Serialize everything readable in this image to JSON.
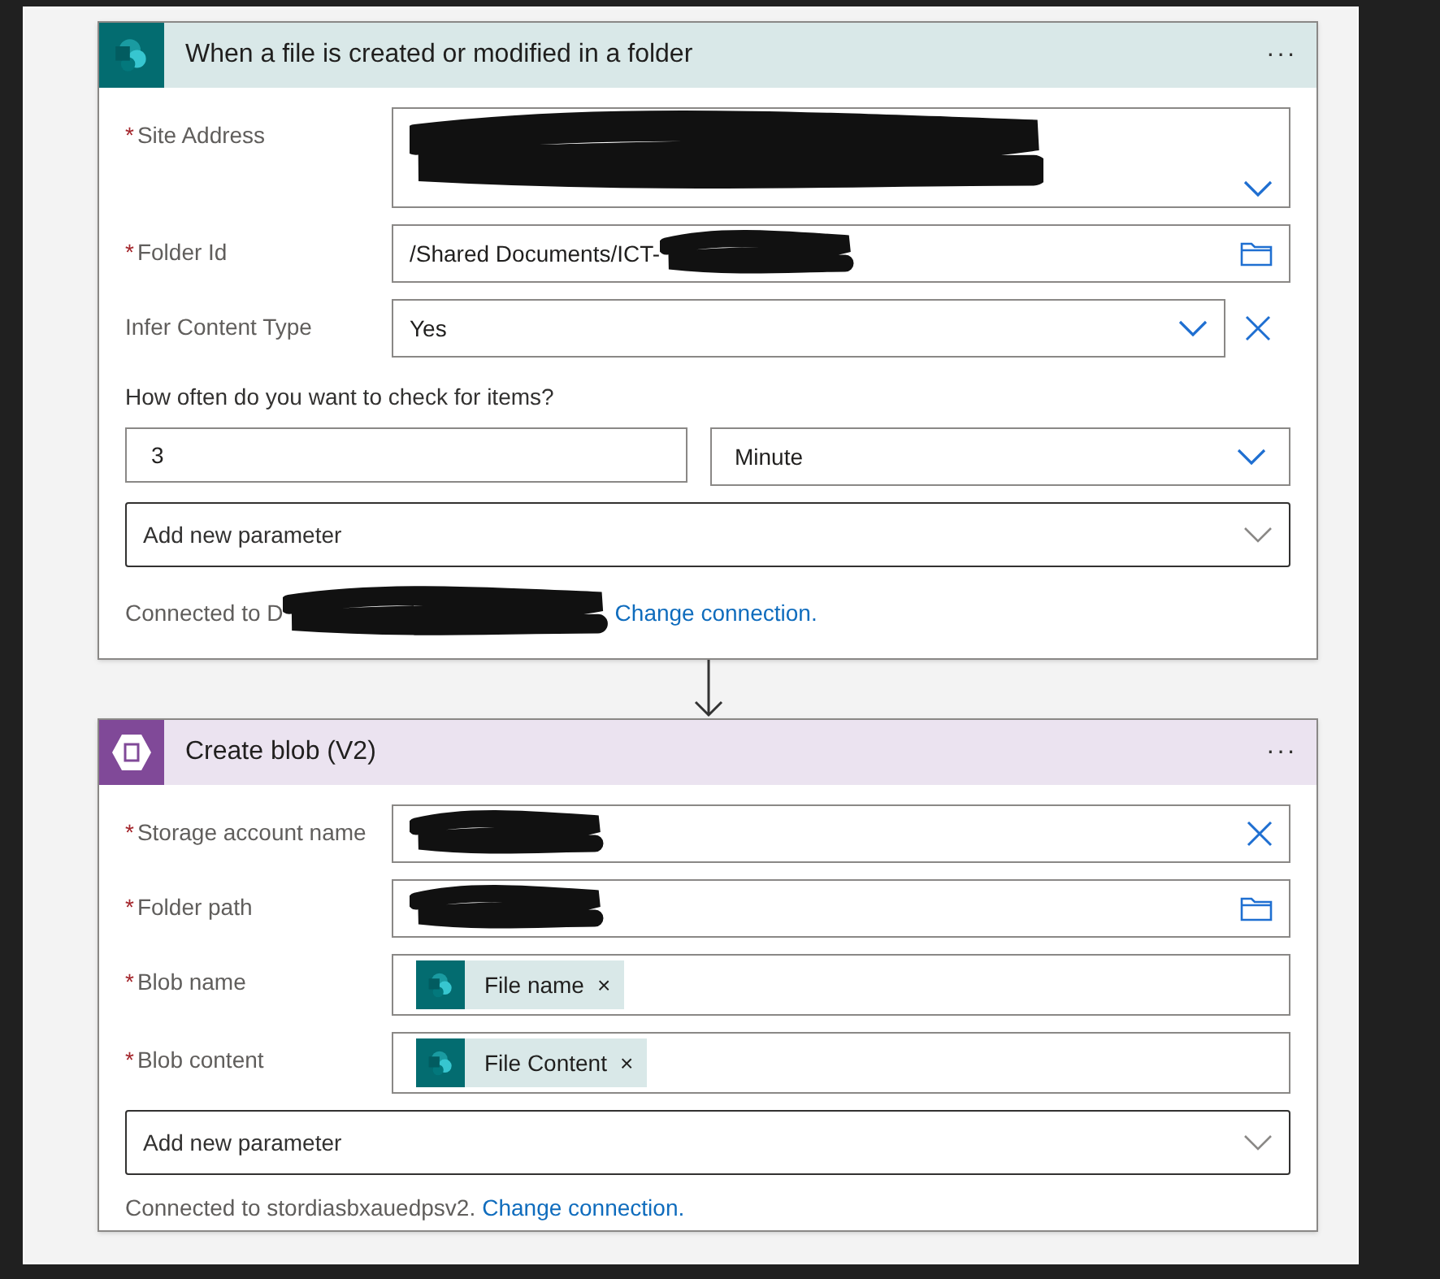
{
  "cards": [
    {
      "kind": "sharepoint",
      "title": "When a file is created or modified in a folder",
      "menu": "···",
      "fields": [
        {
          "kind": "tall_select",
          "label": "Site Address",
          "required_mark": "*",
          "redacted": true
        },
        {
          "kind": "folder",
          "label": "Folder Id",
          "required_mark": "*",
          "value": "/Shared Documents/ICT-",
          "redacted": true
        },
        {
          "kind": "select",
          "label": "Infer Content Type",
          "value": "Yes",
          "removable": true
        }
      ],
      "interval": {
        "prompt": "How often do you want to check for items?",
        "count": "3",
        "unit": "Minute"
      },
      "add_parameter": "Add new parameter",
      "connection": {
        "text": "Connected to D",
        "redacted": true,
        "link": "Change connection."
      }
    },
    {
      "kind": "blob",
      "title": "Create blob (V2)",
      "menu": "···",
      "fields": [
        {
          "kind": "clearable",
          "label": "Storage account name",
          "required_mark": "*",
          "redacted": true
        },
        {
          "kind": "folder",
          "label": "Folder path",
          "required_mark": "*",
          "redacted": true
        },
        {
          "kind": "tokens",
          "label": "Blob name",
          "required_mark": "*",
          "tokens": [
            {
              "text": "File name",
              "close": "×"
            }
          ]
        },
        {
          "kind": "tokens",
          "label": "Blob content",
          "required_mark": "*",
          "tokens": [
            {
              "text": "File Content",
              "close": "×"
            }
          ]
        }
      ],
      "add_parameter": "Add new parameter",
      "connection": {
        "text": "Connected to stordiasbxauedpsv2.",
        "link": "Change connection."
      }
    }
  ]
}
